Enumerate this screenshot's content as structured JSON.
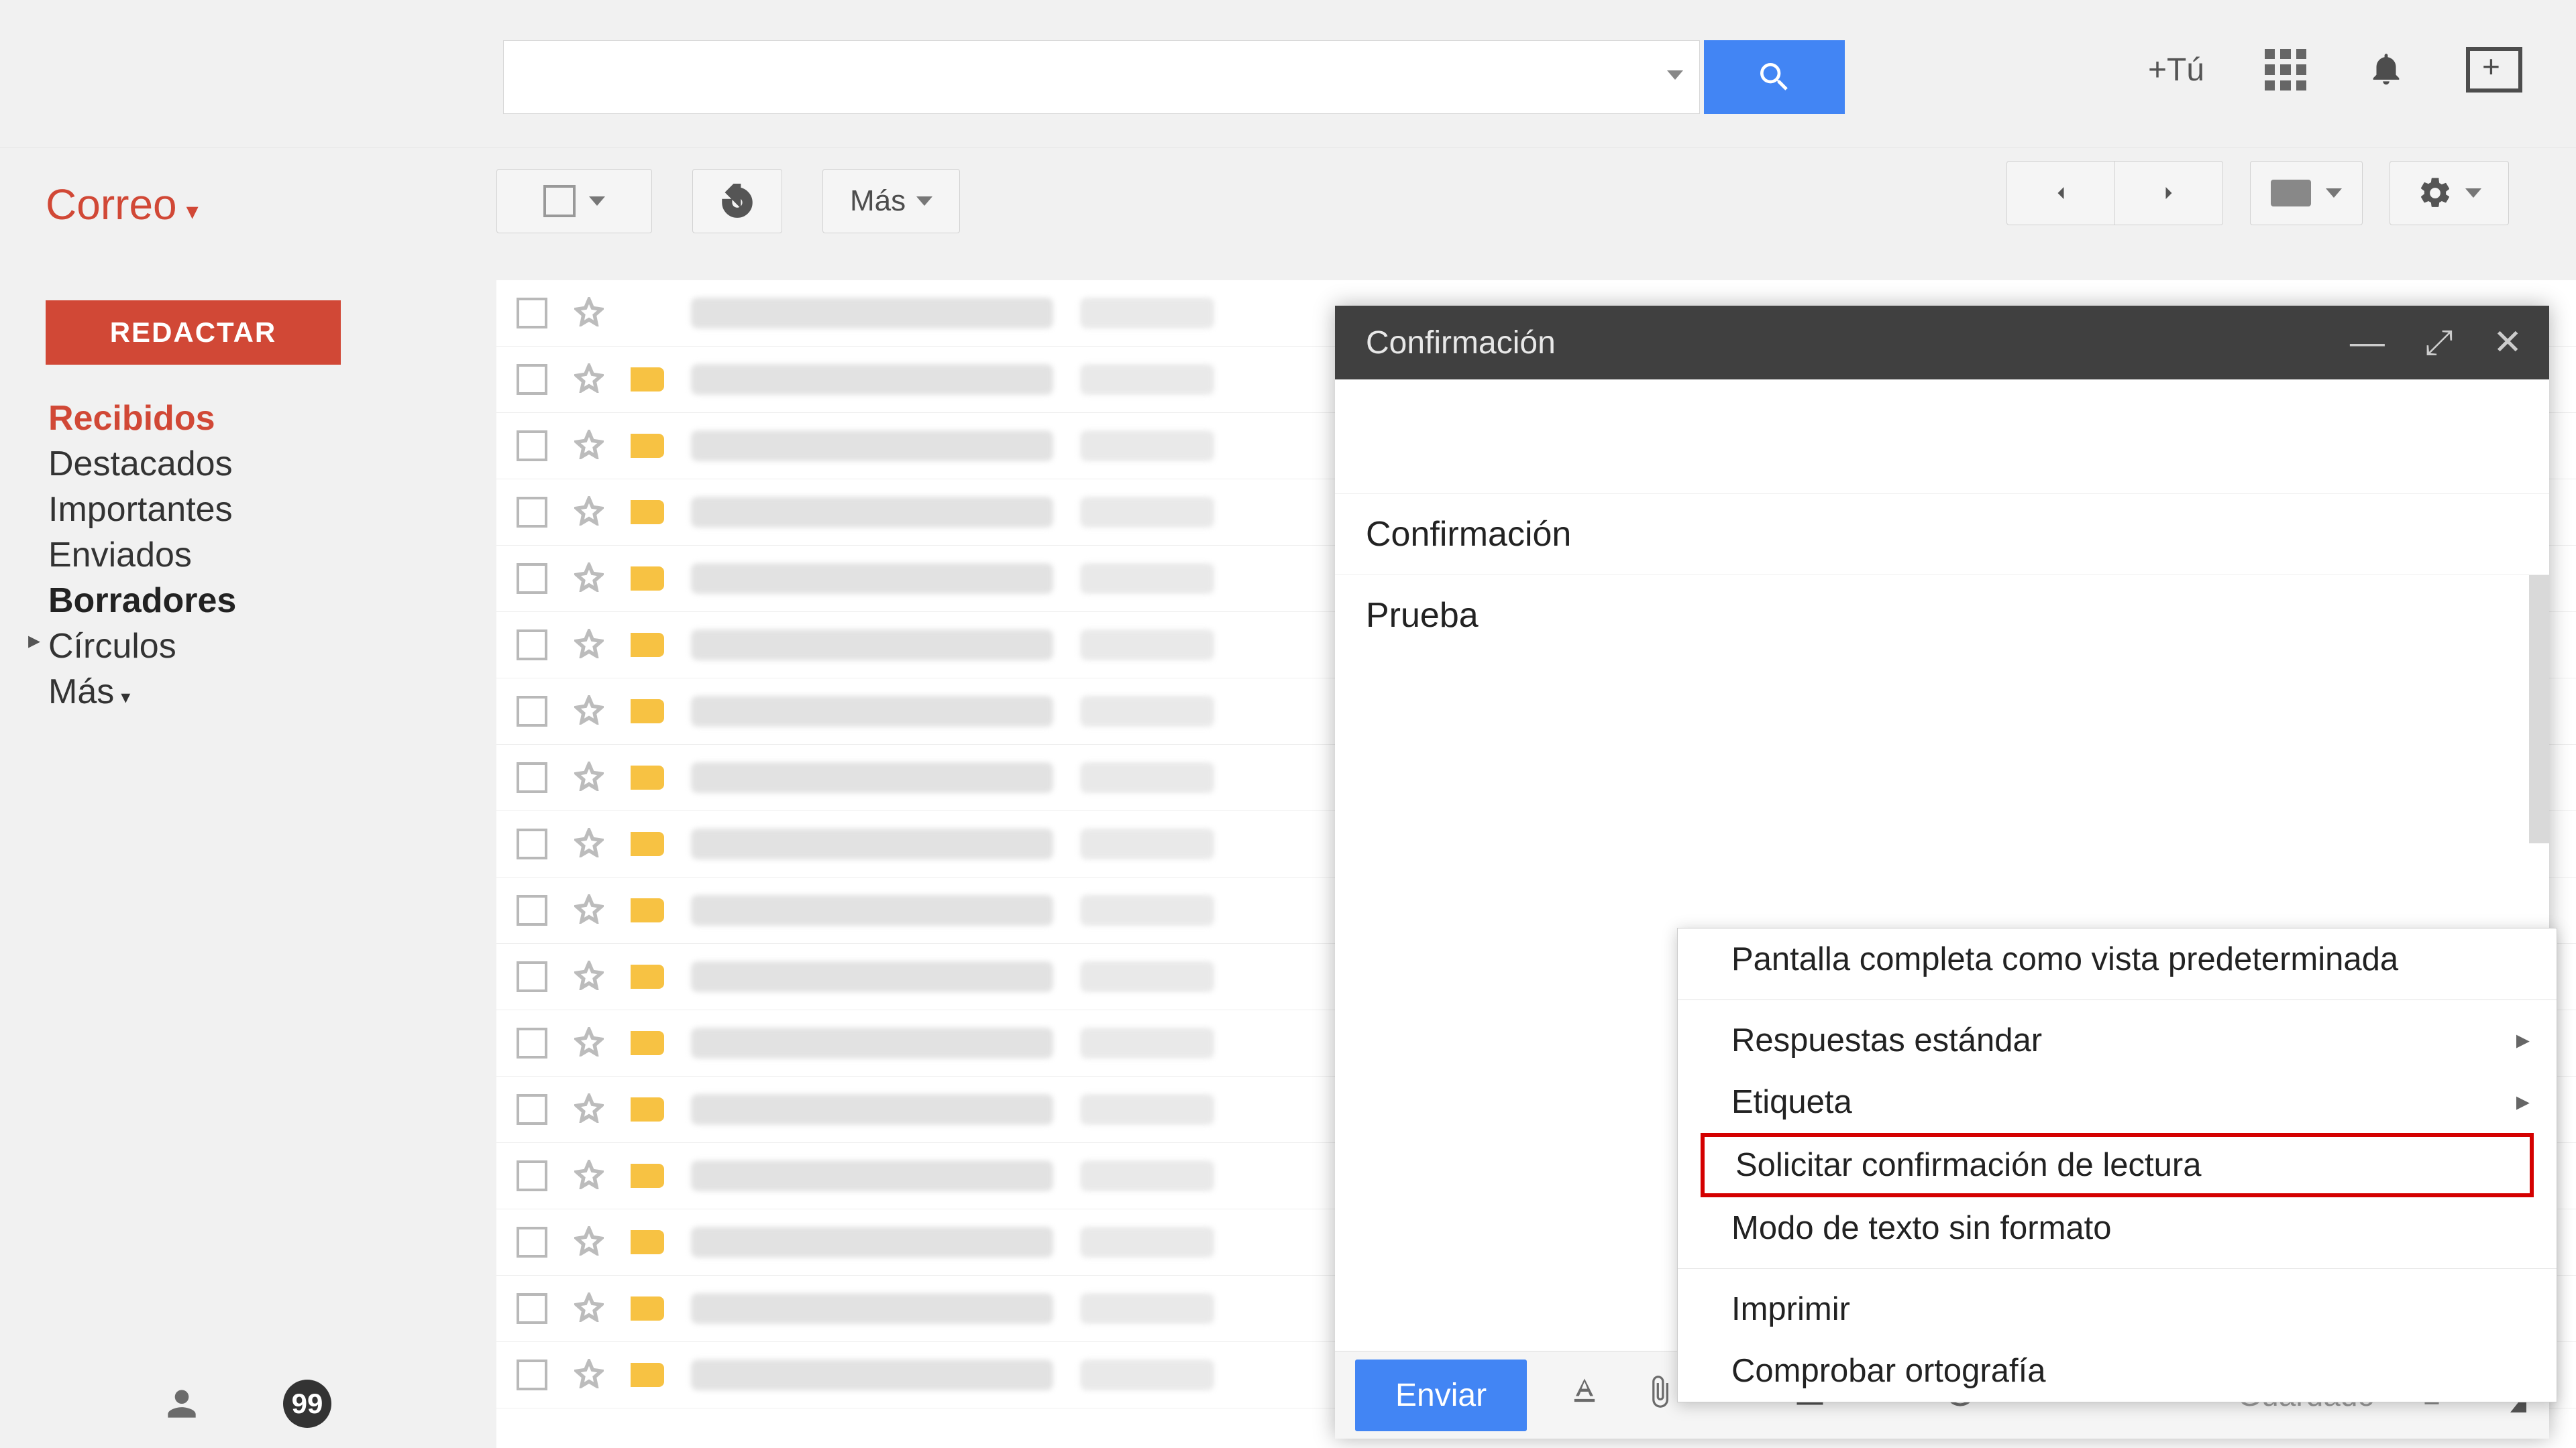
{
  "header": {
    "plus_tu": "+Tú"
  },
  "toolbar": {
    "more_label": "Más"
  },
  "sidebar": {
    "title": "Correo",
    "compose_label": "REDACTAR",
    "items": {
      "inbox": "Recibidos",
      "starred": "Destacados",
      "important": "Importantes",
      "sent": "Enviados",
      "drafts": "Borradores",
      "circles": "Círculos",
      "more": "Más"
    }
  },
  "compose": {
    "title": "Confirmación",
    "subject": "Confirmación",
    "body": "Prueba",
    "send_label": "Enviar",
    "saved_label": "Guardado"
  },
  "context_menu": {
    "fullscreen": "Pantalla completa como vista predeterminada",
    "canned": "Respuestas estándar",
    "label": "Etiqueta",
    "read_receipt": "Solicitar confirmación de lectura",
    "plain_text": "Modo de texto sin formato",
    "print": "Imprimir",
    "spellcheck": "Comprobar ortografía"
  }
}
